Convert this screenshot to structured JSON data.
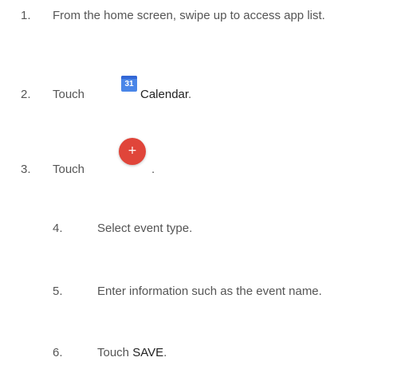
{
  "steps": [
    {
      "number": "1.",
      "text": "From the home screen, swipe up to access app list."
    },
    {
      "number": "2.",
      "text_before": "Touch",
      "icon": "calendar-app-icon",
      "icon_text": "31",
      "label": "Calendar",
      "after": "."
    },
    {
      "number": "3.",
      "text_before": "Touch",
      "icon": "add-fab-icon",
      "icon_glyph": "+",
      "after": "."
    },
    {
      "number": "4.",
      "text": "Select event type."
    },
    {
      "number": "5.",
      "text": "Enter information such as the event name."
    },
    {
      "number": "6.",
      "text_before": "Touch",
      "label": "SAVE",
      "after": "."
    }
  ],
  "colors": {
    "text": "#555555",
    "emphasis": "#222222",
    "calendar_blue": "#4a86e8",
    "fab_red": "#e0453a"
  }
}
